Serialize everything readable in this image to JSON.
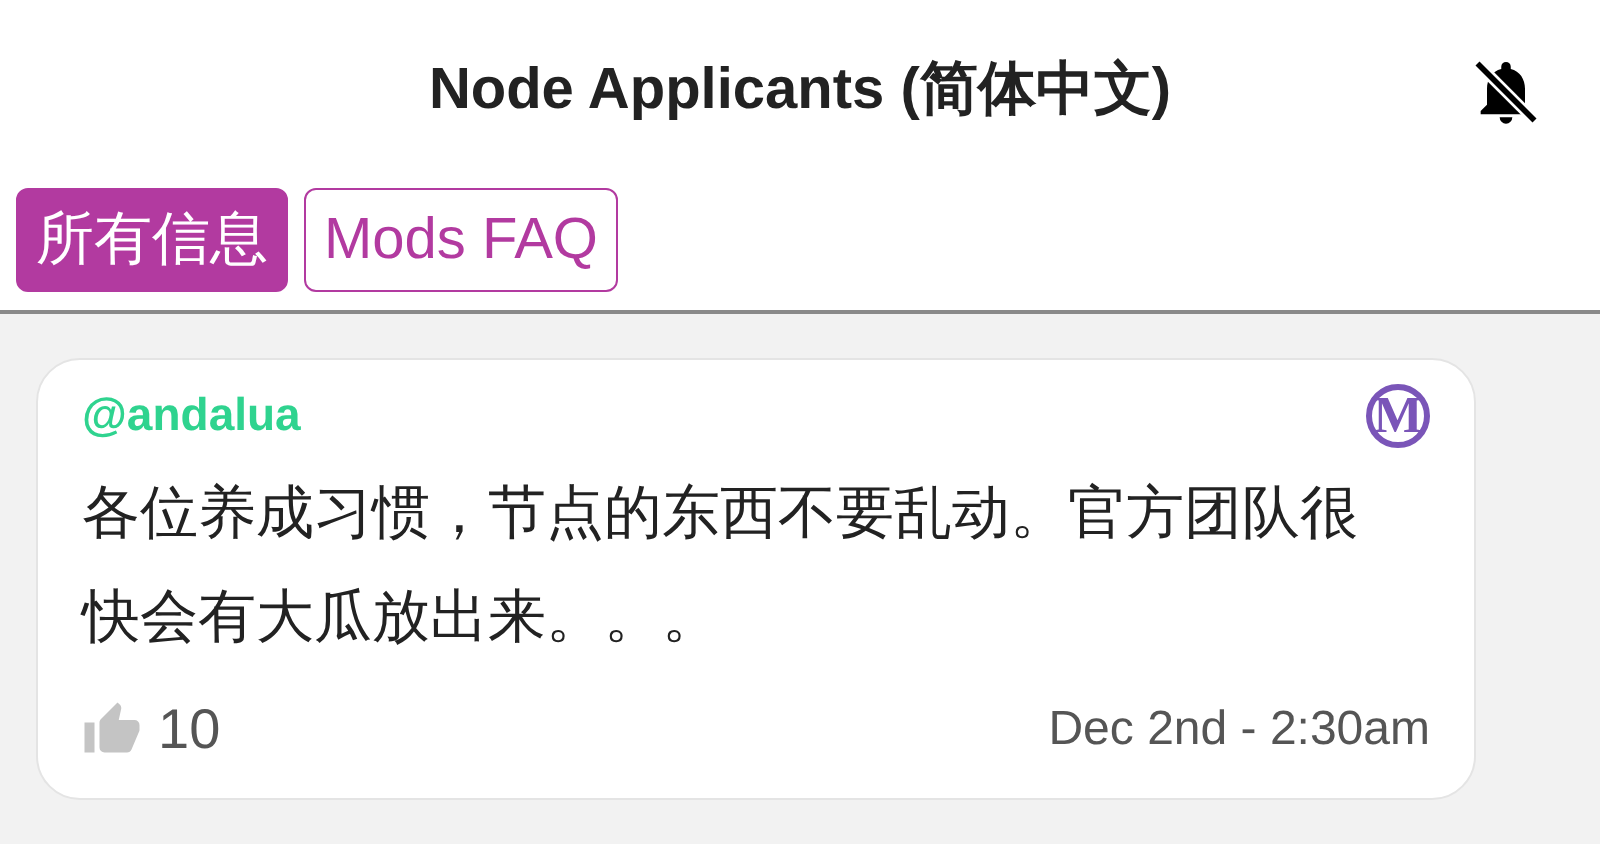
{
  "header": {
    "title": "Node Applicants (简体中文)",
    "notifications_muted": true
  },
  "tabs": [
    {
      "label": "所有信息",
      "selected": true
    },
    {
      "label": "Mods FAQ",
      "selected": false
    }
  ],
  "message": {
    "author": "@andalua",
    "badge": "M",
    "text": "各位养成习惯，节点的东西不要乱动。官方团队很快会有大瓜放出来。。。",
    "likes": "10",
    "time": "Dec 2nd - 2:30am"
  }
}
